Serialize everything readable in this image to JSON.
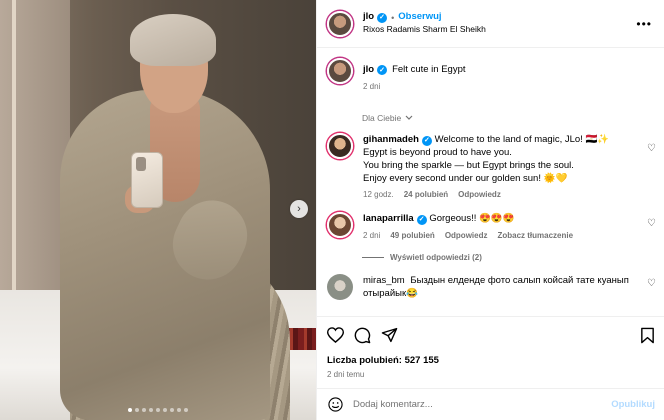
{
  "post": {
    "username": "jlo",
    "follow_label": "Obserwuj",
    "location": "Rixos Radamis Sharm El Sheikh",
    "caption": "Felt cute in Egypt",
    "caption_time": "2 dni",
    "more_icon": "more-horizontal-icon"
  },
  "carousel": {
    "slides": 9,
    "active_index": 0,
    "next_icon": "chevron-right-icon"
  },
  "comments_section": {
    "sort_label": "Dla Ciebie",
    "comments": [
      {
        "username": "gihanmadeh",
        "verified": true,
        "text_lines": [
          "Welcome to the land of magic, JLo! 🇪🇬✨",
          "Egypt is beyond proud to have you.",
          "You bring the sparkle — but Egypt brings the soul.",
          "Enjoy every second under our golden sun! 🌞💛"
        ],
        "time": "12 godz.",
        "likes": "24 polubień",
        "reply": "Odpowiedz",
        "translate": ""
      },
      {
        "username": "lanaparrilla",
        "verified": true,
        "text_lines": [
          "Gorgeous!! 😍😍😍"
        ],
        "time": "2 dni",
        "likes": "49 polubień",
        "reply": "Odpowiedz",
        "translate": "Zobacz tłumaczenie",
        "see_replies": "Wyświetl odpowiedzi (2)"
      },
      {
        "username": "miras_bm",
        "verified": false,
        "text_lines": [
          "Быздын елденде фото салып койсай тате куанып",
          "отырайык😂"
        ],
        "time": "",
        "likes": "",
        "reply": "",
        "translate": ""
      }
    ]
  },
  "actions": {
    "like_icon": "heart-icon",
    "comment_icon": "comment-icon",
    "share_icon": "share-icon",
    "save_icon": "bookmark-icon",
    "likes_label": "Liczba polubień: 527 155",
    "date": "2 dni temu"
  },
  "composer": {
    "placeholder": "Dodaj komentarz...",
    "post_label": "Opublikuj",
    "emoji_icon": "emoji-icon"
  },
  "colors": {
    "accent": "#0095f6",
    "muted": "#737373",
    "post_disabled": "#b3dbff"
  }
}
